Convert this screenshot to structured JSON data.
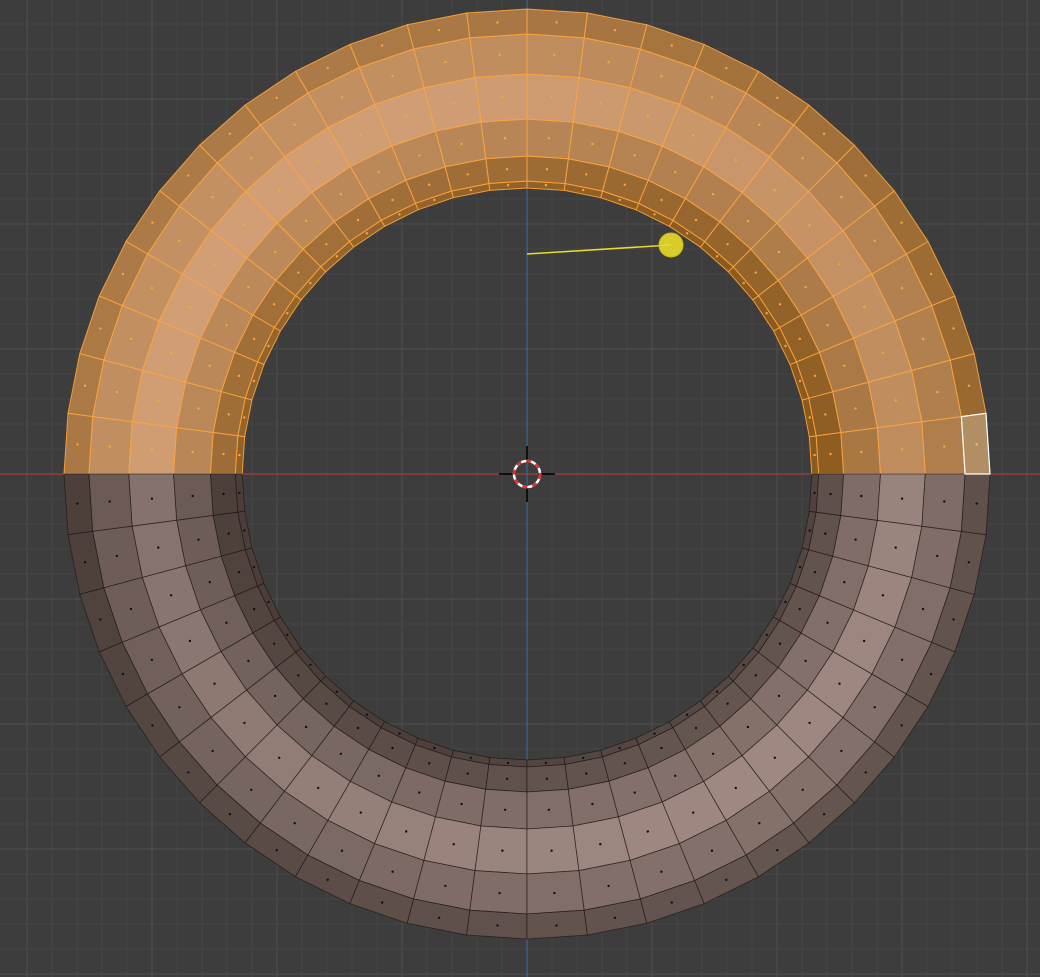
{
  "viewport": {
    "mode": "edit-mesh",
    "view": "top-orthographic",
    "background": "#3d3d3d",
    "grid": {
      "minor_color": "#454545",
      "major_color": "#4f4f4f"
    },
    "axes": {
      "x_color": "#bf3a3a",
      "y_color": "#3b6fa8"
    }
  },
  "mesh": {
    "object": "torus",
    "rings": 48,
    "segments": 6,
    "selection": "upper-half",
    "colors": {
      "selected_face_light": "#d6a27a",
      "selected_face_dark": "#8a5a1e",
      "selected_edge": "#ffa43b",
      "face_light": "#b39a93",
      "face_dark": "#4b3e39",
      "edge": "#1a1412",
      "active_face_outline": "#ffffff"
    }
  },
  "cursor_3d": {
    "icon": "crosshair-icon",
    "color_a": "#e03030",
    "color_b": "#ffffff"
  },
  "gizmo": {
    "icon": "rotate-pivot-icon",
    "color": "#e8dc2a"
  }
}
